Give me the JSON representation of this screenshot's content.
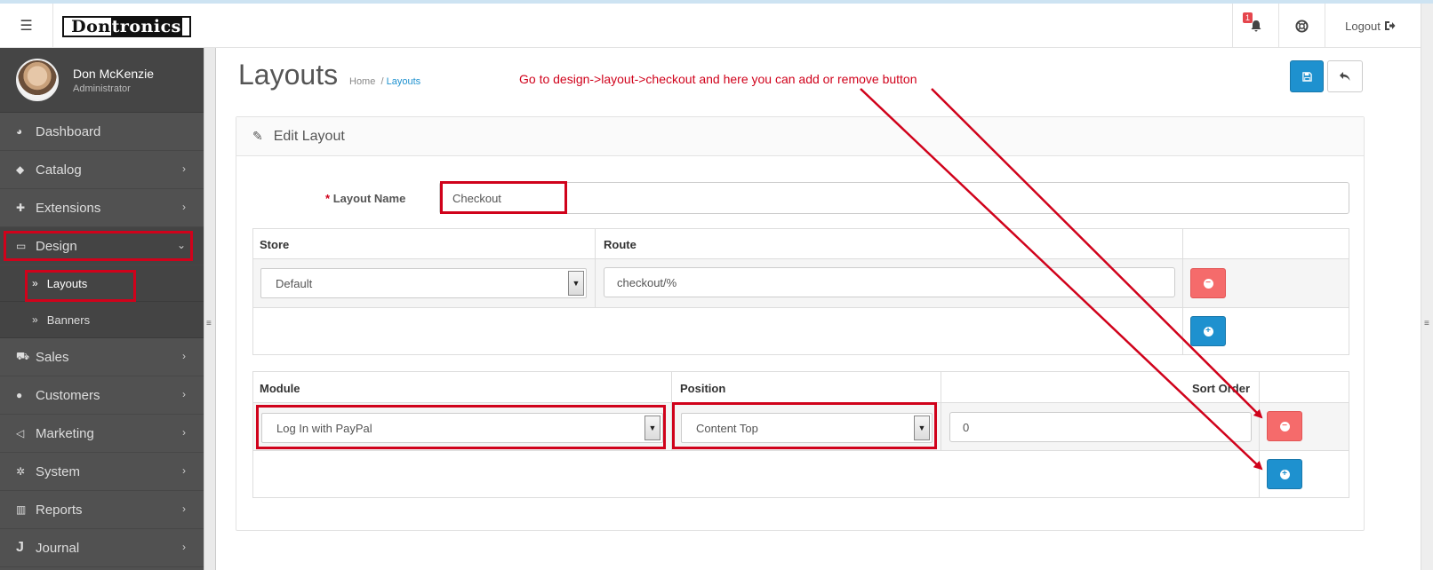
{
  "header": {
    "logo_text_1": "Don",
    "logo_text_2": "tronics",
    "notification_count": "1",
    "logout_label": "Logout"
  },
  "profile": {
    "name": "Don McKenzie",
    "role": "Administrator"
  },
  "sidebar": {
    "items": [
      {
        "label": "Dashboard",
        "icon": "dashboard-icon"
      },
      {
        "label": "Catalog",
        "icon": "tags-icon"
      },
      {
        "label": "Extensions",
        "icon": "puzzle-icon"
      },
      {
        "label": "Design",
        "icon": "monitor-icon"
      },
      {
        "label": "Sales",
        "icon": "cart-icon"
      },
      {
        "label": "Customers",
        "icon": "user-icon"
      },
      {
        "label": "Marketing",
        "icon": "share-icon"
      },
      {
        "label": "System",
        "icon": "cog-icon"
      },
      {
        "label": "Reports",
        "icon": "bar-chart-icon"
      },
      {
        "label": "Journal",
        "icon": "j-icon"
      }
    ],
    "design_sub": [
      {
        "label": "Layouts"
      },
      {
        "label": "Banners"
      }
    ]
  },
  "page": {
    "title": "Layouts",
    "breadcrumb_home": "Home",
    "breadcrumb_sep": "/",
    "breadcrumb_current": "Layouts",
    "annotation": "Go to design->layout->checkout and here you can add or remove button"
  },
  "panel": {
    "heading": "Edit Layout",
    "layout_name_label": "Layout Name",
    "layout_name_required": "*",
    "layout_name_value": "Checkout"
  },
  "route_table": {
    "headers": [
      "Store",
      "Route"
    ],
    "store_value": "Default",
    "route_value": "checkout/%"
  },
  "module_table": {
    "headers": [
      "Module",
      "Position",
      "Sort Order"
    ],
    "module_value": "Log In with PayPal",
    "position_value": "Content Top",
    "sort_order_value": "0"
  },
  "colors": {
    "primary": "#1e91cf",
    "danger": "#f56b6b",
    "annotation_red": "#d0021b",
    "sidebar": "#515151"
  }
}
